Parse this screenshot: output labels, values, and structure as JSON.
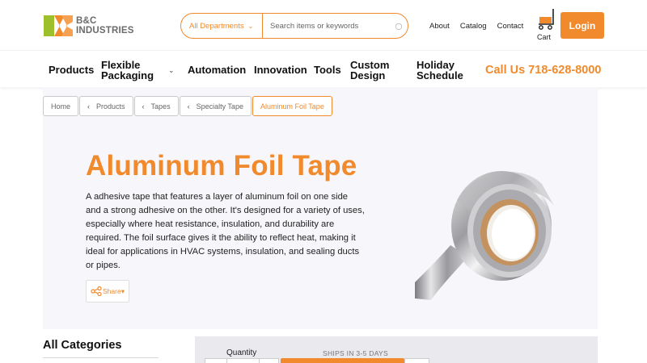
{
  "brand": {
    "name": "B&C INDUSTRIES"
  },
  "search": {
    "department": "All Departments",
    "placeholder": "Search items or keywords"
  },
  "top_links": {
    "about": "About",
    "catalog": "Catalog",
    "contact": "Contact"
  },
  "cart": {
    "label": "Cart"
  },
  "login": {
    "label": "Login"
  },
  "nav": {
    "products": "Products",
    "flexible_line1": "Flexible",
    "flexible_line2": "Packaging",
    "automation": "Automation",
    "innovation": "Innovation",
    "tools": "Tools",
    "custom_line1": "Custom",
    "custom_line2": "Design",
    "holiday_line1": "Holiday",
    "holiday_line2": "Schedule",
    "call": "Call Us 718-628-8000"
  },
  "breadcrumb": [
    "Home",
    "Products",
    "Tapes",
    "Specialty Tape",
    "Aluminum Foil Tape"
  ],
  "product": {
    "title": "Aluminum Foil Tape",
    "description": "A adhesive tape that features a layer of aluminum foil on one side and a strong adhesive on the other. It's designed for a variety of uses, especially where heat resistance, insulation, and durability are required. The foil surface gives it the ability to reflect heat, making it ideal for applications in HVAC systems, insulation, and sealing ducts or pipes.",
    "share_label": "Share"
  },
  "sidebar": {
    "heading": "All Categories"
  },
  "purchase": {
    "quantity_label": "Quantity",
    "ships_label": "SHIPS IN 3-5 DAYS"
  },
  "colors": {
    "accent": "#f08a2c",
    "logo_green": "#9cbf2b",
    "logo_orange": "#f08a2c"
  },
  "icons": [
    "logo-mark",
    "chevron-down-icon",
    "search-icon",
    "cart-icon",
    "share-icon",
    "chevron-left-icon"
  ]
}
